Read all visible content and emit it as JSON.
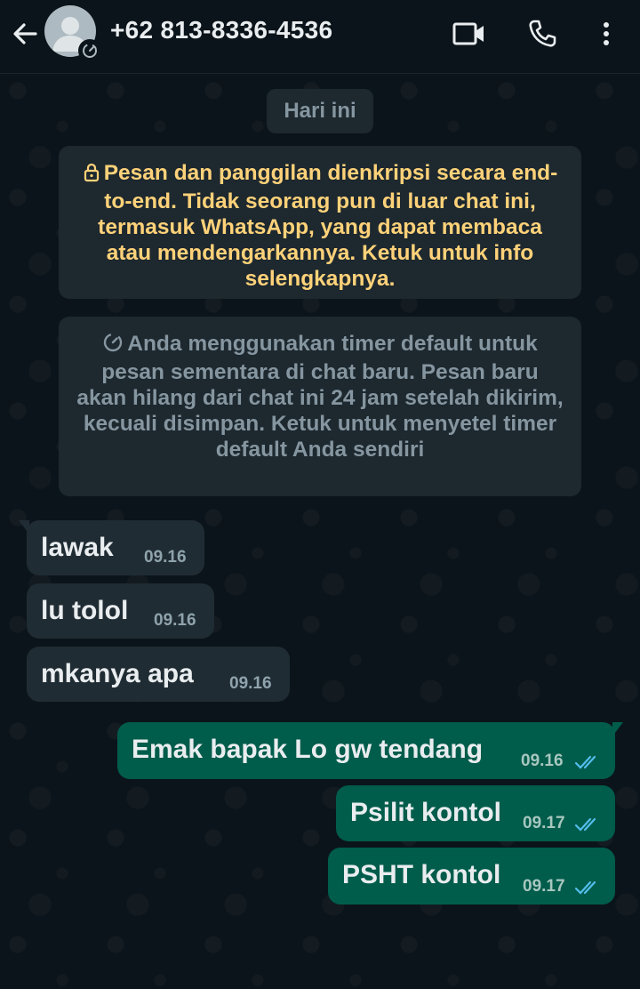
{
  "header": {
    "contact_name": "+62 813-8336-4536",
    "icons": [
      "back-arrow-icon",
      "default-avatar-icon",
      "disappearing-timer-icon",
      "video-call-icon",
      "voice-call-icon",
      "more-options-icon"
    ]
  },
  "chat": {
    "date_label": "Hari ini",
    "encryption_notice": "Pesan dan panggilan dienkripsi secara end-to-end. Tidak seorang pun di luar chat ini, termasuk WhatsApp, yang dapat membaca atau mendengarkannya. Ketuk untuk info selengkapnya.",
    "timer_notice": "Anda menggunakan timer default untuk pesan sementara di chat baru. Pesan baru akan hilang dari chat ini 24 jam setelah dikirim, kecuali disimpan. Ketuk untuk menyetel timer default Anda sendiri",
    "messages": [
      {
        "direction": "incoming",
        "text": "lawak",
        "time": "09.16"
      },
      {
        "direction": "incoming",
        "text": "lu tolol",
        "time": "09.16"
      },
      {
        "direction": "incoming",
        "text": "mkanya apa",
        "time": "09.16"
      },
      {
        "direction": "outgoing",
        "text": "Emak bapak Lo gw tendang",
        "time": "09.16",
        "status": "read"
      },
      {
        "direction": "outgoing",
        "text": "Psilit kontol",
        "time": "09.17",
        "status": "read"
      },
      {
        "direction": "outgoing",
        "text": "PSHT kontol",
        "time": "09.17",
        "status": "read"
      }
    ]
  },
  "colors": {
    "background": "#0b141a",
    "incoming_bubble": "#202c33",
    "outgoing_bubble": "#005c4b",
    "notice_text": "#ffd279",
    "read_ticks": "#53bdeb"
  }
}
